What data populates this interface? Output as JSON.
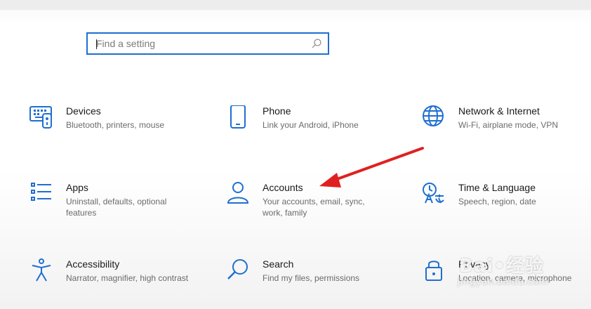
{
  "search": {
    "placeholder": "Find a setting"
  },
  "tiles": [
    {
      "title": "Devices",
      "desc": "Bluetooth, printers, mouse",
      "icon": "devices-icon"
    },
    {
      "title": "Phone",
      "desc": "Link your Android, iPhone",
      "icon": "phone-icon"
    },
    {
      "title": "Network & Internet",
      "desc": "Wi-Fi, airplane mode, VPN",
      "icon": "globe-icon"
    },
    {
      "title": "Apps",
      "desc": "Uninstall, defaults, optional features",
      "icon": "apps-list-icon"
    },
    {
      "title": "Accounts",
      "desc": "Your accounts, email, sync, work, family",
      "icon": "person-icon"
    },
    {
      "title": "Time & Language",
      "desc": "Speech, region, date",
      "icon": "time-language-icon"
    },
    {
      "title": "Accessibility",
      "desc": "Narrator, magnifier, high contrast",
      "icon": "accessibility-icon"
    },
    {
      "title": "Search",
      "desc": "Find my files, permissions",
      "icon": "search-magnifier-icon"
    },
    {
      "title": "Privacy",
      "desc": "Location, camera, microphone",
      "icon": "lock-icon"
    }
  ],
  "accent_color": "#1f6fd0",
  "annotation_color": "#e02020",
  "watermark": {
    "brand": "Bai•经验",
    "url": "jingyan.baidu.com"
  }
}
